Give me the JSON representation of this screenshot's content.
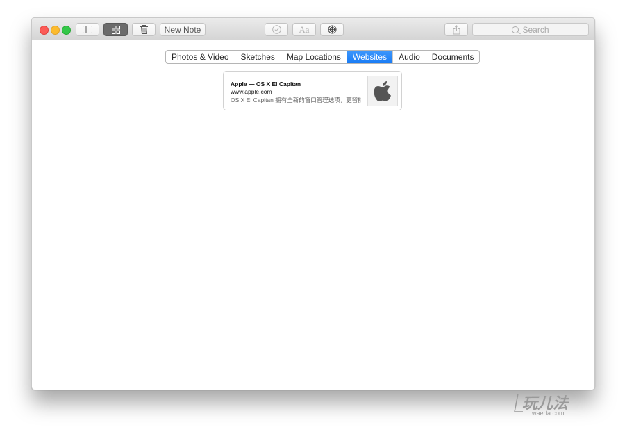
{
  "toolbar": {
    "new_note_label": "New Note",
    "search_placeholder": "Search"
  },
  "icons": {
    "sidebar": "sidebar-toggle-icon",
    "gallery": "attachment-browser-icon",
    "trash": "trash-icon",
    "checklist": "checklist-icon",
    "format": "text-format-icon",
    "share_people": "add-people-icon",
    "share": "share-icon",
    "search": "search-icon"
  },
  "tabs": [
    {
      "label": "Photos & Video",
      "active": false
    },
    {
      "label": "Sketches",
      "active": false
    },
    {
      "label": "Map Locations",
      "active": false
    },
    {
      "label": "Websites",
      "active": true
    },
    {
      "label": "Audio",
      "active": false
    },
    {
      "label": "Documents",
      "active": false
    }
  ],
  "website_card": {
    "title": "Apple — OS X El Capitan",
    "url": "www.apple.com",
    "description": "OS X El Capitan 拥有全新的窗口管理选项，更智能",
    "thumbnail": "apple-logo"
  },
  "watermark": {
    "main": "玩儿法",
    "sub": "waerfa.com"
  },
  "colors": {
    "accent": "#1a7cf5",
    "close": "#fc5b57",
    "minimize": "#fcbb2e",
    "zoom": "#33c748"
  }
}
